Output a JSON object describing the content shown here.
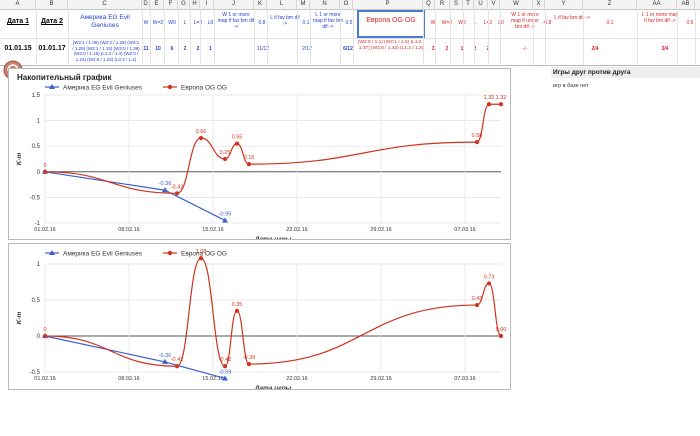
{
  "columns": [
    "A",
    "B",
    "C",
    "D",
    "E",
    "F",
    "G",
    "H",
    "I",
    "J",
    "K",
    "L",
    "M",
    "N",
    "O",
    "P",
    "Q",
    "R",
    "S",
    "T",
    "U",
    "V",
    "W",
    "X",
    "Y",
    "Z",
    "AA",
    "AB"
  ],
  "header": {
    "date1": "Дата 1",
    "date2": "Дата 2",
    "team1": "Америка EG Evil Geniuses",
    "w": "W",
    "w2": "W=2",
    "w0": "W0",
    "l": "L",
    "l2": "L=2",
    "l0": "L0",
    "w1more": "W 1 or more map if fav bm dif ->",
    "k_val": "0.8",
    "lfav": "L if fav bm dif ->",
    "m_val": "0.1",
    "l1more": "L 1 or more map if fav bm dif ->",
    "o_val": "0.5",
    "team2": "Европа OG OG",
    "w_r": "W",
    "w2_r": "W=2",
    "w0_r": "W0",
    "l_r": "L",
    "l2_r": "L=2",
    "l0_r": "L0",
    "w1more_r": "W 1 or more map if under bm dif ->",
    "x_val": "-0.8",
    "lfav_r": "L if fav bm dif ->",
    "z_val": "0.1",
    "l1more_r": "L 1 or more map if fav bm dif ->",
    "ab_val": "0.5"
  },
  "row": {
    "date1": "01.01.15",
    "date2": "01.01.17",
    "team1_stats": "(W2:1 / 1.09) (W2:2 / 1.29) (W3:1 / 1.29) (W2:1 / 1.15) (W2:0 / 1.38) (W2:0 / 1.16) (L1:2 / 1.4) (W2:0 / 1.24) (W2:0 / 1.24) (L0:2 / 1.4)",
    "e": "11",
    "f": "10",
    "g": "6",
    "h": "2",
    "i": "2",
    "j": "1",
    "k": "11/12",
    "m": "2/12",
    "o": "6/12",
    "team2_stats": "(W2:0 / 1.1) (W2:1 / 1.5) (L1:2 / 1.37) (W1:0 / 1.42) (L1:2 / 1.2)",
    "q": "3",
    "r": "2",
    "s": "1",
    "t": "2",
    "u": "2",
    "w": "-/-",
    "z": "2/4",
    "ab": "3/4"
  },
  "right_panel": {
    "title": "Игры друг против друга",
    "note": "игр в базе нет"
  },
  "colors": {
    "series1": "#3a5fcd",
    "series2": "#d0331f",
    "header_blue": "#1f3fd1",
    "header_red": "#d22222"
  },
  "chart_data": [
    {
      "type": "line",
      "title": "Накопительный график",
      "xlabel": "Дата игры",
      "ylabel": "K-т",
      "x_ticks": [
        "01.02.16",
        "08.02.16",
        "15.02.16",
        "22.02.16",
        "29.02.16",
        "07.03.16"
      ],
      "ylim": [
        -1,
        1.5
      ],
      "y_ticks": [
        -1,
        -0.5,
        0,
        0.5,
        1,
        1.5
      ],
      "grid": true,
      "legend_position": "top-left",
      "series": [
        {
          "name": "Америка EG Evil Geniuses",
          "points": [
            {
              "x": "01.02.16",
              "y": 0,
              "label": ""
            },
            {
              "x": "11.02.16",
              "y": -0.36,
              "label": "-0.36"
            },
            {
              "x": "16.02.16",
              "y": -0.95,
              "label": "-0.95"
            }
          ]
        },
        {
          "name": "Европа OG OG",
          "points": [
            {
              "x": "01.02.16",
              "y": 0,
              "label": "0"
            },
            {
              "x": "12.02.16",
              "y": -0.42,
              "label": "-0.42"
            },
            {
              "x": "14.02.16",
              "y": 0.66,
              "label": "0.66"
            },
            {
              "x": "16.02.16",
              "y": 0.25,
              "label": "0.25"
            },
            {
              "x": "17.02.16",
              "y": 0.55,
              "label": "0.55"
            },
            {
              "x": "18.02.16",
              "y": 0.15,
              "label": "0.15"
            },
            {
              "x": "08.03.16",
              "y": 0.58,
              "label": "0.58"
            },
            {
              "x": "09.03.16",
              "y": 1.32,
              "label": "1.32"
            },
            {
              "x": "10.03.16",
              "y": 1.32,
              "label": "1.32"
            }
          ]
        }
      ]
    },
    {
      "type": "line",
      "title": "",
      "xlabel": "Дата игры",
      "ylabel": "K-т",
      "x_ticks": [
        "01.02.16",
        "08.02.16",
        "15.02.16",
        "22.02.16",
        "29.02.16",
        "07.03.16"
      ],
      "ylim": [
        -0.5,
        1
      ],
      "y_ticks": [
        -0.5,
        0,
        0.5,
        1
      ],
      "grid": true,
      "legend_position": "top-left",
      "series": [
        {
          "name": "Америка EG Evil Geniuses",
          "points": [
            {
              "x": "01.02.16",
              "y": 0,
              "label": ""
            },
            {
              "x": "11.02.16",
              "y": -0.36,
              "label": "-0.36"
            },
            {
              "x": "16.02.16",
              "y": -0.59,
              "label": "-0.59"
            }
          ]
        },
        {
          "name": "Европа OG OG",
          "points": [
            {
              "x": "01.02.16",
              "y": 0,
              "label": "0"
            },
            {
              "x": "12.02.16",
              "y": -0.42,
              "label": "-0.42"
            },
            {
              "x": "14.02.16",
              "y": 1.08,
              "label": "1.08"
            },
            {
              "x": "16.02.16",
              "y": -0.42,
              "label": "-0.42"
            },
            {
              "x": "17.02.16",
              "y": 0.35,
              "label": "0.35"
            },
            {
              "x": "18.02.16",
              "y": -0.39,
              "label": "-0.39"
            },
            {
              "x": "08.03.16",
              "y": 0.43,
              "label": "0.43"
            },
            {
              "x": "09.03.16",
              "y": 0.73,
              "label": "0.73"
            },
            {
              "x": "10.03.16",
              "y": 0,
              "label": "0.00"
            }
          ]
        }
      ]
    }
  ]
}
